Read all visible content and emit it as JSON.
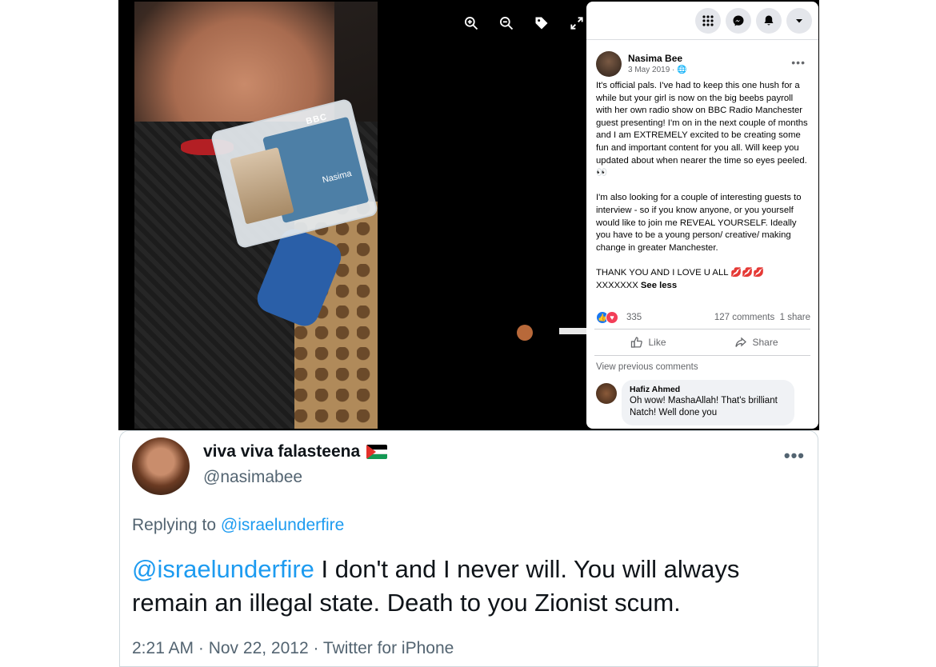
{
  "facebook": {
    "viewer_tools": {
      "icons": [
        "zoom-in-icon",
        "zoom-out-icon",
        "tag-icon",
        "fullscreen-icon"
      ]
    },
    "top_bar": {
      "icons": [
        "menu-grid-icon",
        "messenger-icon",
        "notifications-icon",
        "account-dropdown-icon"
      ]
    },
    "post": {
      "author": "Nasima Bee",
      "date": "3 May 2019 · 🌐",
      "more": "•••",
      "body_paragraph_1": "It's official pals. I've had to keep this one hush for a while but your girl is now on the big beebs payroll with her own radio show on BBC Radio Manchester guest presenting! I'm on in the next couple of months and I am EXTREMELY excited to be creating some fun and important content for you all. Will keep you updated about when nearer the time so eyes peeled. 👀",
      "body_paragraph_2": "I'm also looking for a couple of interesting guests to interview - so if you know anyone, or you yourself would like to join me REVEAL YOURSELF. Ideally you have to be a young person/ creative/ making change in greater Manchester.",
      "body_paragraph_3": "THANK YOU AND I LOVE U ALL 💋💋💋\nXXXXXXX",
      "see_less": "See less",
      "reaction_count": "335",
      "comments_count": "127 comments",
      "shares_count": "1 share",
      "like_label": "Like",
      "share_label": "Share",
      "view_previous": "View previous comments"
    },
    "comment": {
      "author": "Hafiz Ahmed",
      "text": "Oh wow! MashaAllah! That's brilliant Natch! Well done you"
    },
    "badge": {
      "logo": "BBC",
      "name": "Nasima"
    }
  },
  "tweet": {
    "display_name": "viva viva falasteena",
    "handle": "@nasimabee",
    "more": "•••",
    "replying_prefix": "Replying to ",
    "replying_to": "@israelunderfire",
    "body_mention": "@israelunderfire",
    "body_text": " I don't and I never will. You will always remain an illegal state. Death to you Zionist scum.",
    "timestamp": "2:21 AM · Nov 22, 2012 · Twitter for iPhone"
  },
  "colors": {
    "facebook_blue": "#1877f2",
    "twitter_blue": "#1d9bf0",
    "love_red": "#f33e58",
    "secondary_text": "#65676b"
  }
}
